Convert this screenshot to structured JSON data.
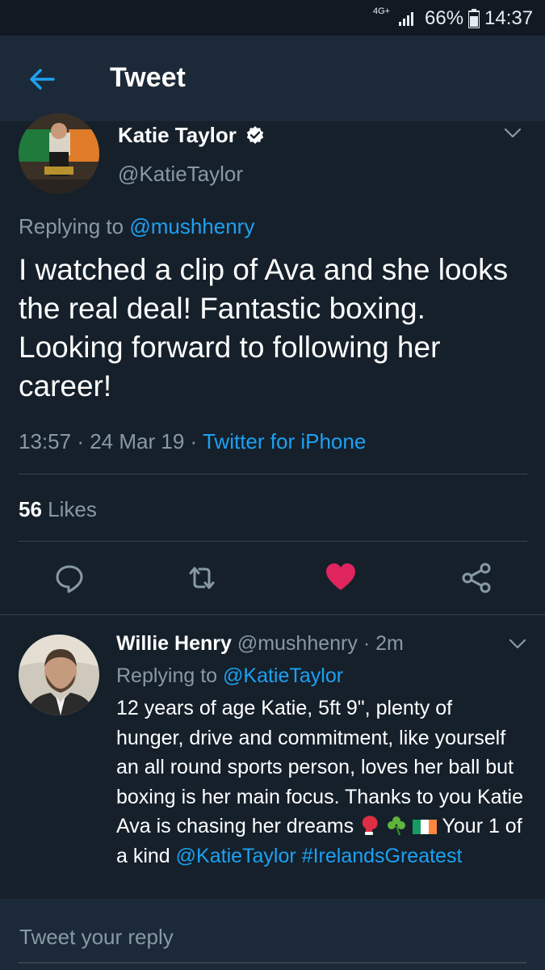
{
  "status_bar": {
    "network": "4G+",
    "battery_percent": "66%",
    "time": "14:37"
  },
  "header": {
    "title": "Tweet",
    "back_icon": "arrow-left-icon"
  },
  "main_tweet": {
    "author_name": "Katie Taylor",
    "author_handle": "@KatieTaylor",
    "replying_prefix": "Replying to",
    "replying_to": "@mushhenry",
    "text": "I watched a clip of Ava and she looks the real deal! Fantastic boxing. Looking forward to following her career!",
    "time": "13:57",
    "date": "24 Mar 19",
    "sep": "·",
    "source": "Twitter for iPhone",
    "likes_count": "56",
    "likes_label": "Likes"
  },
  "actions": {
    "reply_icon": "reply-icon",
    "retweet_icon": "retweet-icon",
    "like_icon": "heart-icon",
    "share_icon": "share-icon",
    "like_color": "#e0245e"
  },
  "reply_tweet": {
    "author_name": "Willie Henry",
    "author_handle": "@mushhenry",
    "sep": "·",
    "time_ago": "2m",
    "replying_prefix": "Replying to",
    "replying_to": "@KatieTaylor",
    "text_main": "12 years of age Katie, 5ft 9\", plenty of hunger, drive and commitment,  like yourself an all round sports person, loves her ball but boxing is her main focus. Thanks to you Katie Ava is chasing her dreams",
    "text_after_emoji": "Your 1 of a kind",
    "mention": "@KatieTaylor",
    "hashtag": "#IrelandsGreatest",
    "emojis": [
      "boxing-glove-icon",
      "shamrock-icon",
      "ireland-flag-icon"
    ]
  },
  "compose": {
    "placeholder": "Tweet your reply"
  },
  "colors": {
    "background": "#15202b",
    "header": "#1c2938",
    "accent": "#1da1f2",
    "secondary_text": "#8899a6"
  }
}
